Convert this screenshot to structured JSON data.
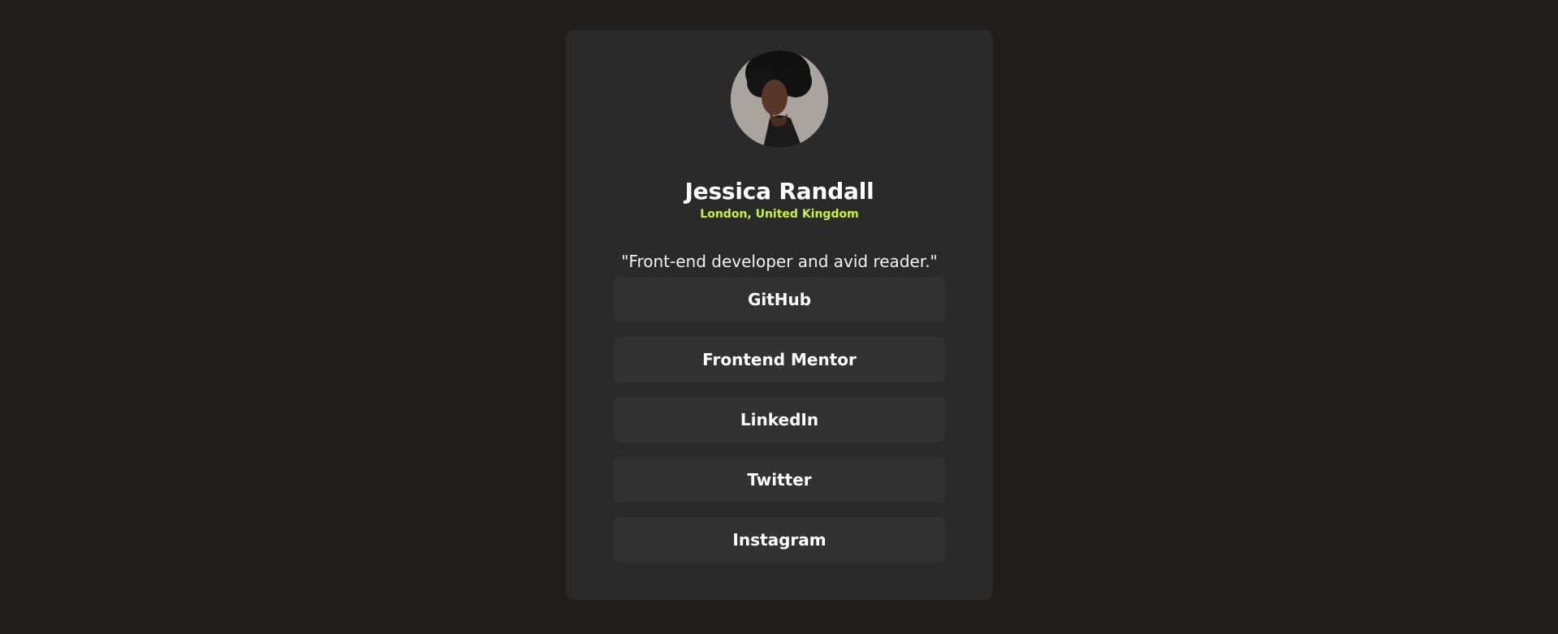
{
  "profile": {
    "name": "Jessica Randall",
    "location": "London, United Kingdom",
    "bio": "\"Front-end developer and avid reader.\""
  },
  "links": [
    {
      "label": "GitHub"
    },
    {
      "label": "Frontend Mentor"
    },
    {
      "label": "LinkedIn"
    },
    {
      "label": "Twitter"
    },
    {
      "label": "Instagram"
    }
  ],
  "colors": {
    "page_background": "#201f1e",
    "card_background": "#2b2a2b",
    "button_background": "#333233",
    "accent": "#c4f82a",
    "text": "#ffffff"
  }
}
